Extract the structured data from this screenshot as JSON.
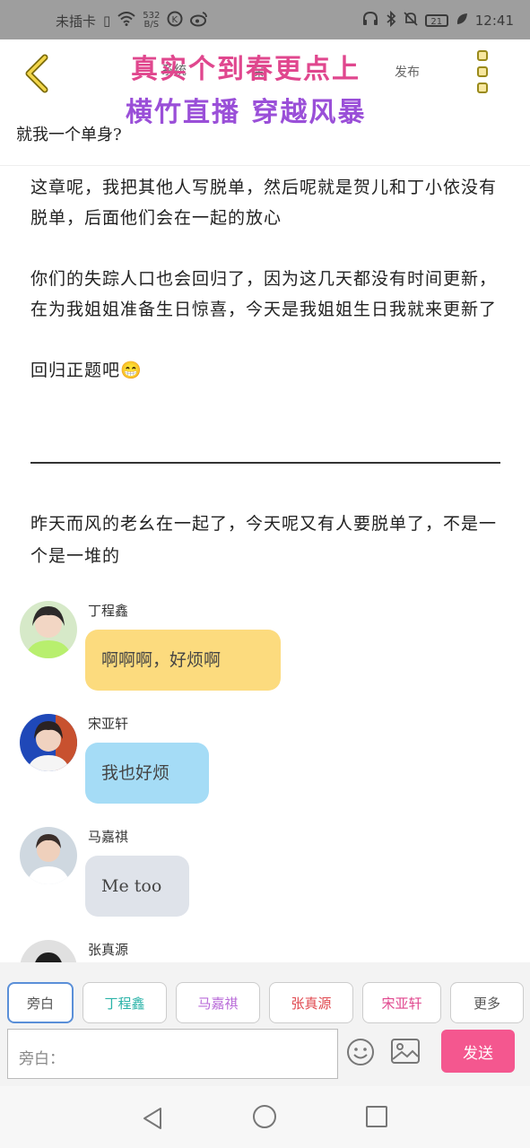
{
  "status_bar": {
    "carrier": "未插卡",
    "speed_value": "532",
    "speed_unit": "B/S",
    "battery": "21",
    "time": "12:41"
  },
  "header": {
    "overlay_line1": "真实个到春更点上",
    "overlay_line2": "横竹直播 穿越风暴",
    "overlay_small1": "系统",
    "overlay_small2": "保",
    "overlay_small3": "发布",
    "subtitle": "就我一个单身?"
  },
  "story": {
    "p1": "这章呢，我把其他人写脱单，然后呢就是贺儿和丁小依没有脱单，后面他们会在一起的放心",
    "p2": "你们的失踪人口也会回归了，因为这几天都没有时间更新，在为我姐姐准备生日惊喜，今天是我姐姐生日我就来更新了",
    "p3": "回归正题吧😁",
    "p4": "昨天而风的老幺在一起了，今天呢又有人要脱单了，不是一个是一堆的"
  },
  "messages": [
    {
      "name": "丁程鑫",
      "text": "啊啊啊，好烦啊",
      "bubble_color": "#fcdb7e"
    },
    {
      "name": "宋亚轩",
      "text": "我也好烦",
      "bubble_color": "#a5dcf6"
    },
    {
      "name": "马嘉祺",
      "text": "Me too",
      "bubble_color": "#dfe3ea"
    },
    {
      "name": "张真源",
      "text": "",
      "bubble_color": "#ffffff"
    }
  ],
  "toolbar": {
    "roles": [
      {
        "label": "旁白",
        "color": "#555555"
      },
      {
        "label": "丁程鑫",
        "color": "#2bb3a8"
      },
      {
        "label": "马嘉祺",
        "color": "#b86ad8"
      },
      {
        "label": "张真源",
        "color": "#e0474e"
      },
      {
        "label": "宋亚轩",
        "color": "#e0478e"
      },
      {
        "label": "更多",
        "color": "#555555"
      }
    ],
    "input_placeholder": "旁白：",
    "send_label": "发送"
  }
}
